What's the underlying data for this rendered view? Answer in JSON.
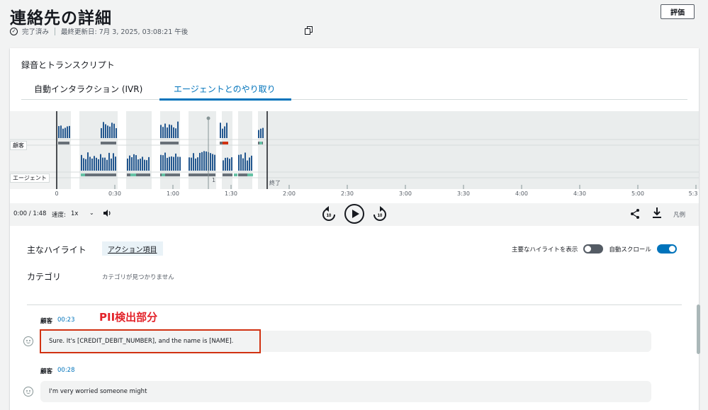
{
  "header": {
    "title": "連絡先の詳細",
    "status": "完了済み",
    "last_updated": "最終更新日: 7月 3, 2025, 03:08:21 午後",
    "rate_button": "評価"
  },
  "recording": {
    "section_title": "録音とトランスクリプト",
    "tabs": [
      {
        "label": "自動インタラクション (IVR)",
        "active": false
      },
      {
        "label": "エージェントとのやり取り",
        "active": true
      }
    ]
  },
  "timeline": {
    "tracks": [
      "顧客",
      "エージェント"
    ],
    "marker_label": "1",
    "end_label": "終了",
    "ticks": [
      "0",
      "0:30",
      "1:00",
      "1:30",
      "2:00",
      "2:30",
      "3:00",
      "3:30",
      "4:00",
      "4:30",
      "5:00",
      "5:3"
    ]
  },
  "player": {
    "time": "0:00 / 1:48",
    "speed_label": "速度:",
    "speed_value": "1x",
    "rewind_label": "10",
    "forward_label": "10",
    "legend_label": "凡例"
  },
  "highlights": {
    "label": "主なハイライト",
    "action_item": "アクション項目",
    "show_highlights_label": "主要なハイライトを表示",
    "auto_scroll_label": "自動スクロール",
    "show_highlights_on": false,
    "auto_scroll_on": true
  },
  "categories": {
    "label": "カテゴリ",
    "empty_text": "カテゴリが見つかりません"
  },
  "annotation": "PII検出部分",
  "transcript": [
    {
      "speaker": "顧客",
      "time": "00:23",
      "text": "Sure. It's [CREDIT_DEBIT_NUMBER], and the name is [NAME]."
    },
    {
      "speaker": "顧客",
      "time": "00:28",
      "text": "I'm very worried someone might"
    }
  ],
  "colors": {
    "accent": "#0073bb",
    "bar": "#23578f",
    "pii_marker": "#d13212",
    "positive": "#66c2a5",
    "annotation": "#e3242b"
  },
  "icons": [
    "check-circle-icon",
    "copy-icon",
    "volume-icon",
    "rewind-10-icon",
    "play-icon",
    "forward-10-icon",
    "share-icon",
    "download-icon",
    "smiley-icon"
  ]
}
